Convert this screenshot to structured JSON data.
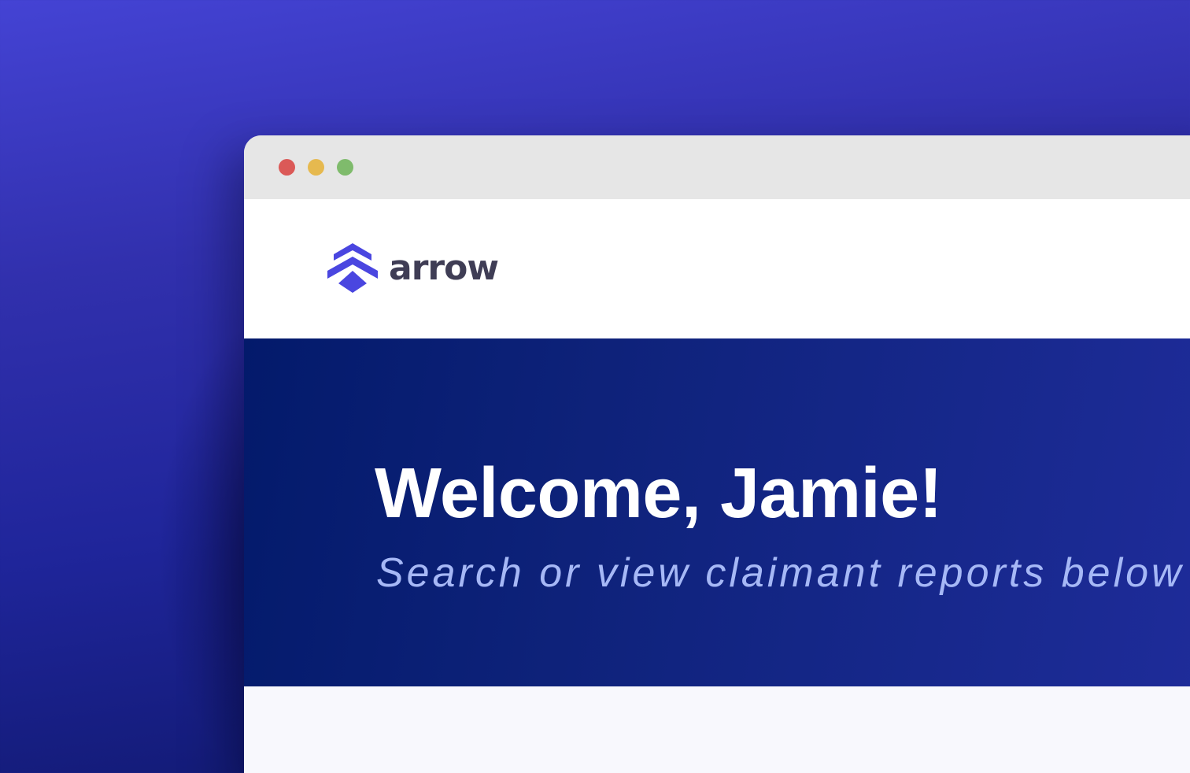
{
  "window": {
    "controls": [
      "close",
      "minimize",
      "maximize"
    ],
    "colors": {
      "close": "#db5957",
      "minimize": "#e6b94f",
      "maximize": "#7fbb6c"
    }
  },
  "header": {
    "logo_icon": "arrow-chevrons-icon",
    "logo_text": "arrow",
    "brand_color": "#4a46e0"
  },
  "hero": {
    "title": "Welcome, Jamie!",
    "subtitle": "Search or view claimant reports below"
  }
}
